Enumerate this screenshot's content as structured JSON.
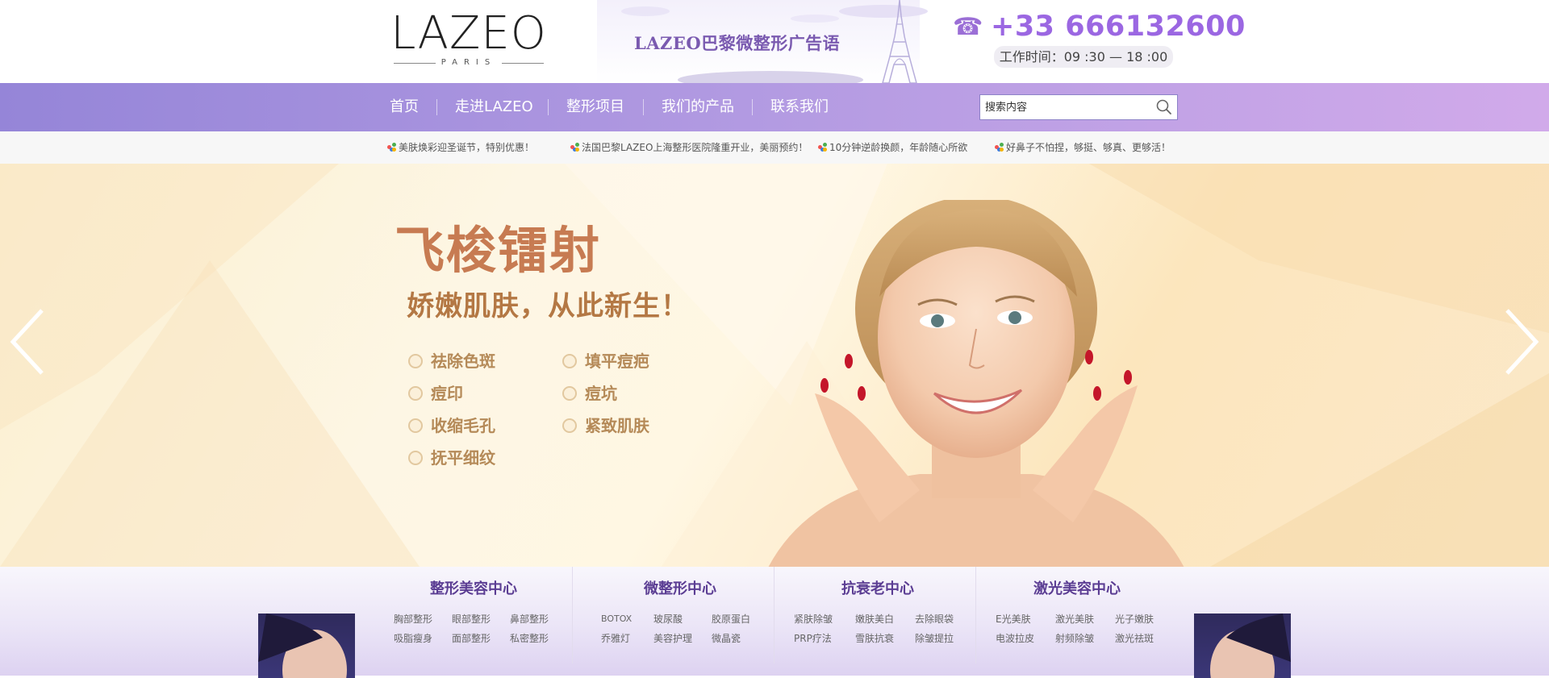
{
  "brand": {
    "logo_text": "LAZEO",
    "logo_sub": "PARIS",
    "slogan": "LAZEO巴黎微整形广告语",
    "phone": "+33 666132600",
    "hours": "工作时间：09 :30 — 18 :00",
    "phone_icon": "phone-icon"
  },
  "nav": {
    "items": [
      "首页",
      "走进LAZEO",
      "整形项目",
      "我们的产品",
      "联系我们"
    ],
    "search_placeholder": "搜索内容",
    "search_icon": "search-icon"
  },
  "news": [
    "美肤焕彩迎圣诞节，特别优惠！",
    "法国巴黎LAZEO上海整形医院隆重开业，美丽预约！",
    "10分钟逆龄换颜，年龄随心所欲",
    "好鼻子不怕捏，够挺、够真、更够活！"
  ],
  "banner": {
    "title": "飞梭镭射",
    "subtitle": "娇嫩肌肤，从此新生！",
    "features": [
      "祛除色斑",
      "填平痘疤",
      "痘印",
      "痘坑",
      "收缩毛孔",
      "紧致肌肤",
      "抚平细纹"
    ],
    "prev_icon": "chevron-left-icon",
    "next_icon": "chevron-right-icon"
  },
  "categories": [
    {
      "title": "整形美容中心",
      "links": [
        "胸部整形",
        "眼部整形",
        "鼻部整形",
        "吸脂瘦身",
        "面部整形",
        "私密整形"
      ]
    },
    {
      "title": "微整形中心",
      "links": [
        "BOTOX",
        "玻尿酸",
        "胶原蛋白",
        "乔雅灯",
        "美容护理",
        "微晶瓷"
      ]
    },
    {
      "title": "抗衰老中心",
      "links": [
        "紧肤除皱",
        "嫩肤美白",
        "去除眼袋",
        "PRP疗法",
        "雪肤抗衰",
        "除皱提拉"
      ]
    },
    {
      "title": "激光美容中心",
      "links": [
        "E光美肤",
        "激光美肤",
        "光子嫩肤",
        "电波拉皮",
        "射频除皱",
        "激光祛斑"
      ]
    }
  ],
  "colors": {
    "accent": "#9b67e2",
    "nav_start": "#9585d8",
    "nav_end": "#d1aaea",
    "banner_title": "#c77b52",
    "category_title": "#5b3d93"
  }
}
